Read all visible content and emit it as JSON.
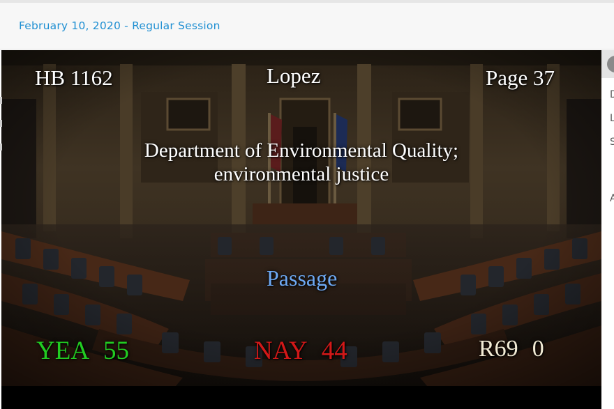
{
  "header": {
    "session_title": "February 10, 2020 - Regular Session"
  },
  "video": {
    "overlay": {
      "bill_number": "HB 1162",
      "patron": "Lopez",
      "page": "Page 37",
      "title_line1": "Department of Environmental Quality;",
      "title_line2": "environmental justice",
      "action": "Passage",
      "yea_label": "YEA",
      "yea_count": "55",
      "nay_label": "NAY",
      "nay_count": "44",
      "abstain_label": "R69",
      "abstain_count": "0"
    },
    "colors": {
      "yea": "#22cc22",
      "nay": "#d21818",
      "action": "#6ea9f3",
      "abstain": "#f3ecd6",
      "header_link": "#1f8fd2"
    }
  },
  "right_panel": {
    "clipped_chars": [
      "D",
      "L",
      "S",
      "A"
    ],
    "avatar_icon": "user-avatar-icon"
  }
}
